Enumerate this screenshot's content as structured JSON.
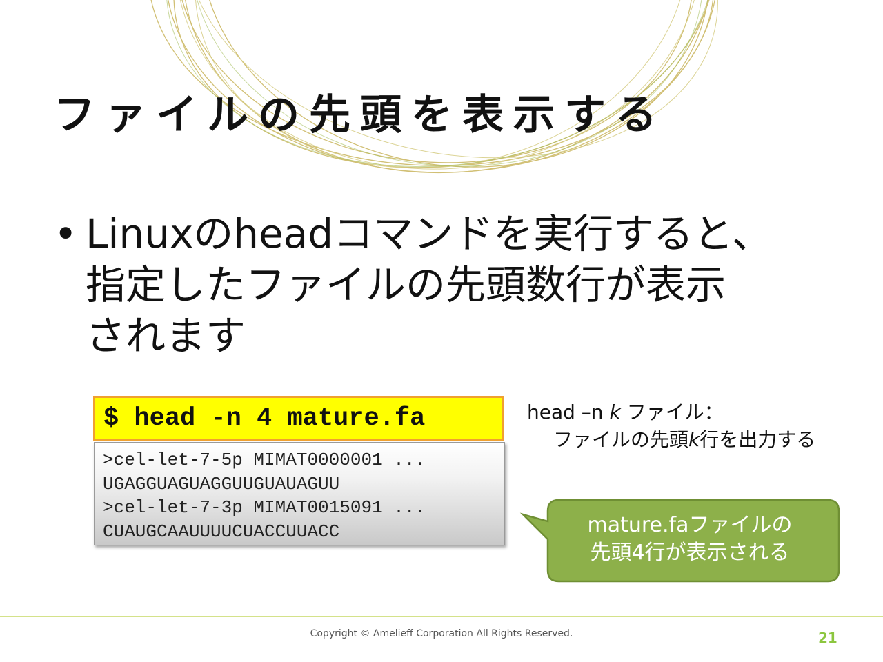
{
  "slide": {
    "title": "ファイルの先頭を表示する",
    "bullet_marker": "•",
    "bullet_lines": [
      "Linuxのheadコマンドを実行すると、",
      "指定したファイルの先頭数行が表示",
      "されます"
    ],
    "command": "$ head -n 4 mature.fa",
    "output_lines": [
      ">cel-let-7-5p MIMAT0000001 ...",
      "UGAGGUAGUAGGUUGUAUAGUU",
      ">cel-let-7-3p MIMAT0015091 ...",
      "CUAUGCAAUUUUCUACCUUACC"
    ],
    "usage": {
      "prefix": "head –n ",
      "k": "k",
      "suffix": " ファイル：",
      "line2_prefix": "ファイルの先頭",
      "line2_k": "k",
      "line2_suffix": "行を出力する"
    },
    "callout_lines": [
      "mature.faファイルの",
      "先頭4行が表示される"
    ],
    "copyright": "Copyright © Amelieff Corporation All Rights Reserved.",
    "page_number": "21"
  },
  "colors": {
    "accent_green": "#8cc63f",
    "callout_fill": "#8db04a",
    "command_highlight": "#ffff00",
    "command_border": "#f0a030",
    "deco_gold": "#c8b45a"
  }
}
